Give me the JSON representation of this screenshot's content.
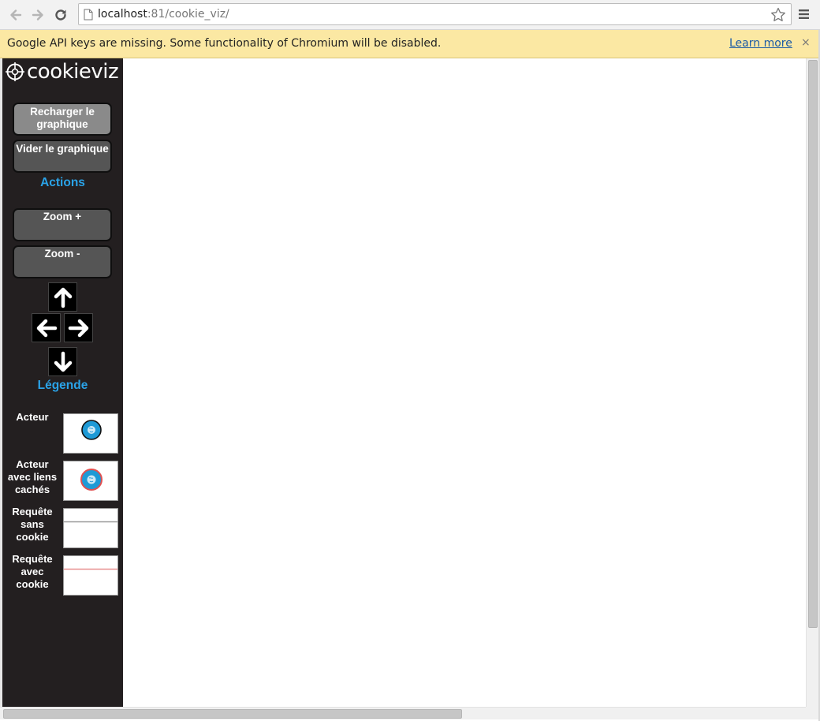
{
  "browser": {
    "url_host": "localhost",
    "url_rest": ":81/cookie_viz/",
    "back_icon": "back-arrow-icon",
    "forward_icon": "forward-arrow-icon",
    "reload_icon": "reload-icon",
    "bookmark_icon": "star-icon",
    "menu_icon": "hamburger-menu-icon"
  },
  "infobar": {
    "message": "Google API keys are missing. Some functionality of Chromium will be disabled.",
    "link": "Learn more",
    "close": "×"
  },
  "sidebar": {
    "logo_text": "cookieviz",
    "buttons": {
      "reload": "Recharger le graphique",
      "clear": "Vider le graphique",
      "zoom_in": "Zoom +",
      "zoom_out": "Zoom -"
    },
    "actions_title": "Actions",
    "legend_title": "Légende",
    "legend": [
      {
        "label": "Acteur"
      },
      {
        "label": "Acteur avec liens cachés"
      },
      {
        "label": "Requête sans cookie"
      },
      {
        "label": "Requête avec cookie"
      }
    ]
  },
  "colors": {
    "sidebar_bg": "#231f20",
    "accent": "#2aa3e8",
    "node_fill": "#1e9ad6",
    "hidden_link_stroke": "#e05050",
    "request_no_cookie": "#999999",
    "request_with_cookie": "#e89090"
  }
}
